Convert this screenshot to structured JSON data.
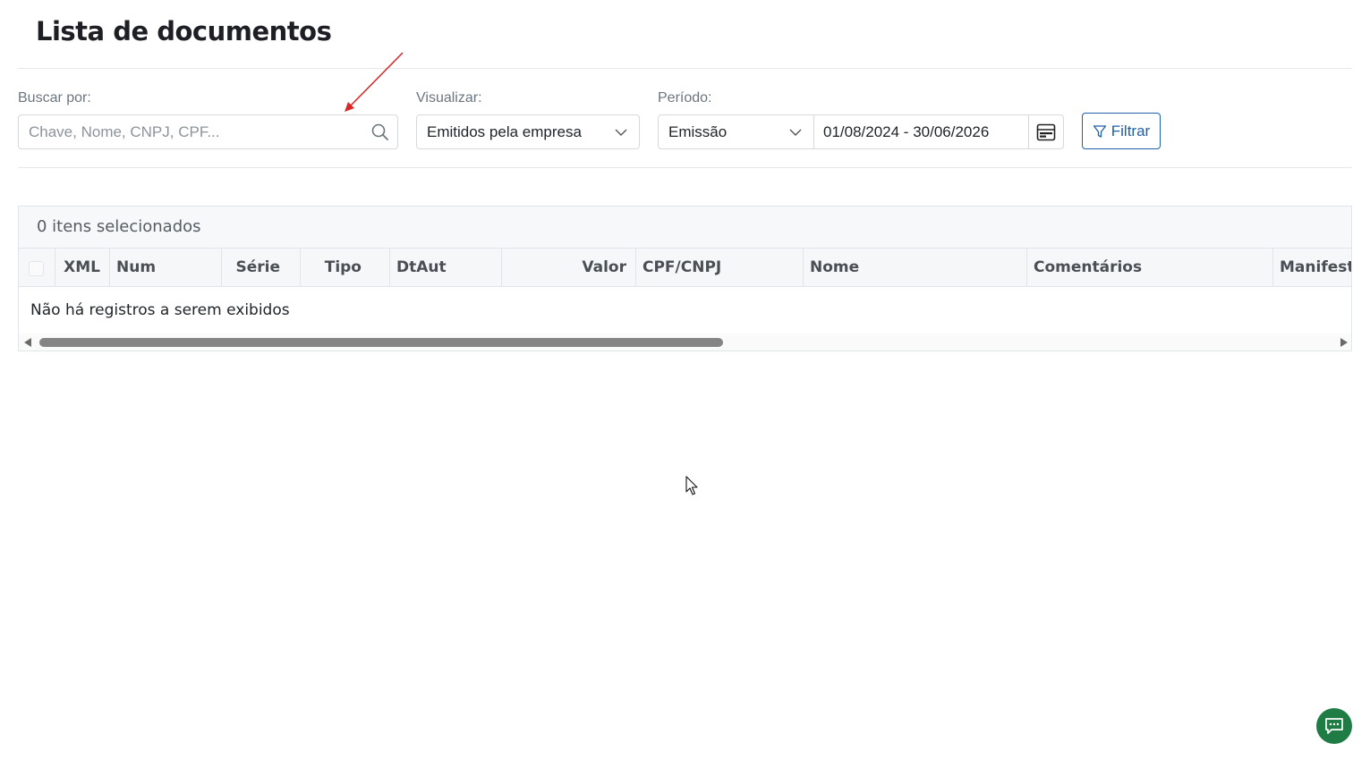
{
  "page": {
    "title": "Lista de documentos"
  },
  "filters": {
    "search": {
      "label": "Buscar por:",
      "placeholder": "Chave, Nome, CNPJ, CPF..."
    },
    "view": {
      "label": "Visualizar:",
      "selected": "Emitidos pela empresa"
    },
    "period": {
      "label": "Período:",
      "type_selected": "Emissão",
      "range": "01/08/2024 - 30/06/2026"
    },
    "filter_button": "Filtrar"
  },
  "table": {
    "selected_count": "0 itens selecionados",
    "columns": [
      "XML",
      "Num",
      "Série",
      "Tipo",
      "DtAut",
      "Valor",
      "CPF/CNPJ",
      "Nome",
      "Comentários",
      "Manifesta"
    ],
    "empty_message": "Não há registros a serem exibidos"
  },
  "colors": {
    "accent": "#1d5fa8",
    "chat": "#1e7c44",
    "annotation_arrow": "#d62828"
  },
  "icons": [
    "search-icon",
    "chevron-down-icon",
    "calendar-icon",
    "filter-icon",
    "chat-icon"
  ]
}
